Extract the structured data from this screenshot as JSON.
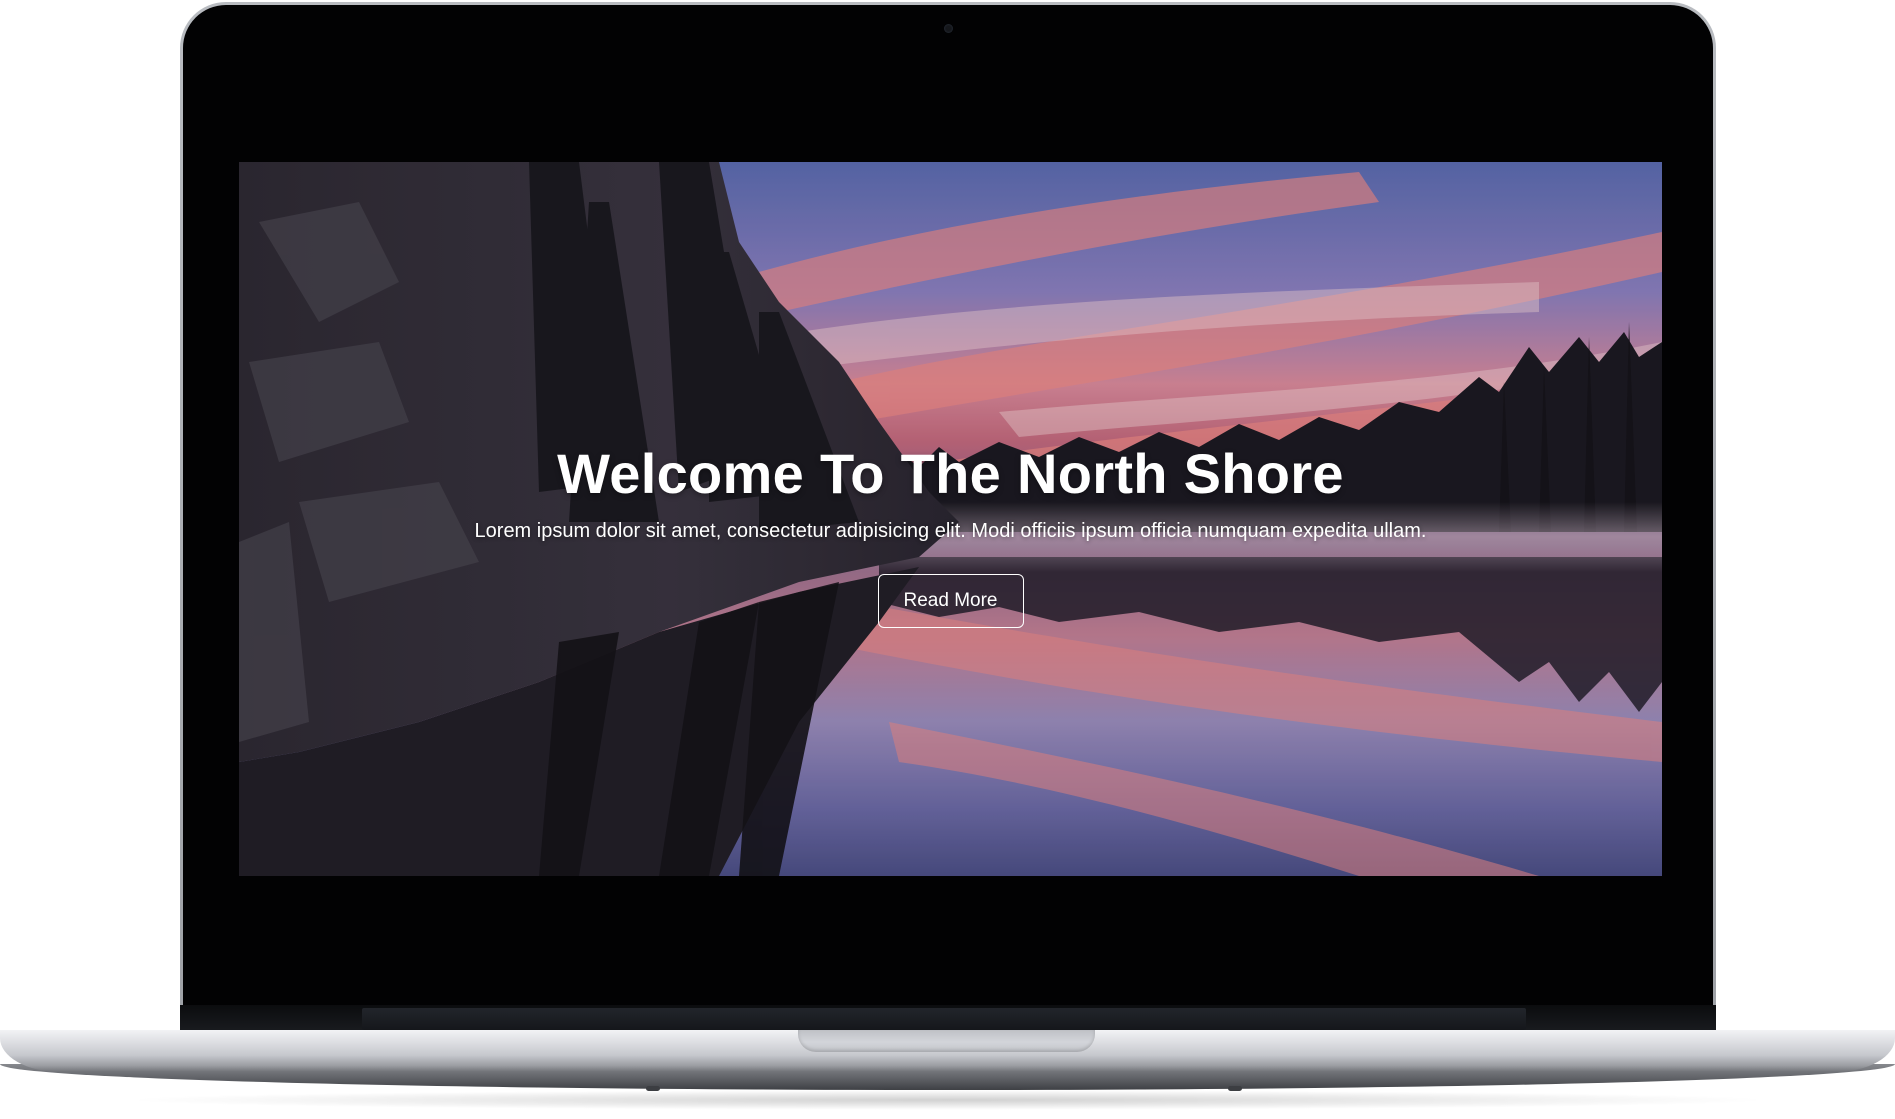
{
  "hero": {
    "title": "Welcome To The North Shore",
    "text": "Lorem ipsum dolor sit amet, consectetur adipisicing elit. Modi officiis ipsum officia numquam expedita ullam.",
    "button_label": "Read More",
    "background": "lake-sunset-photo"
  },
  "device": {
    "type": "laptop-mockup"
  },
  "colors": {
    "text": "#ffffff",
    "bezel": "#020203"
  }
}
